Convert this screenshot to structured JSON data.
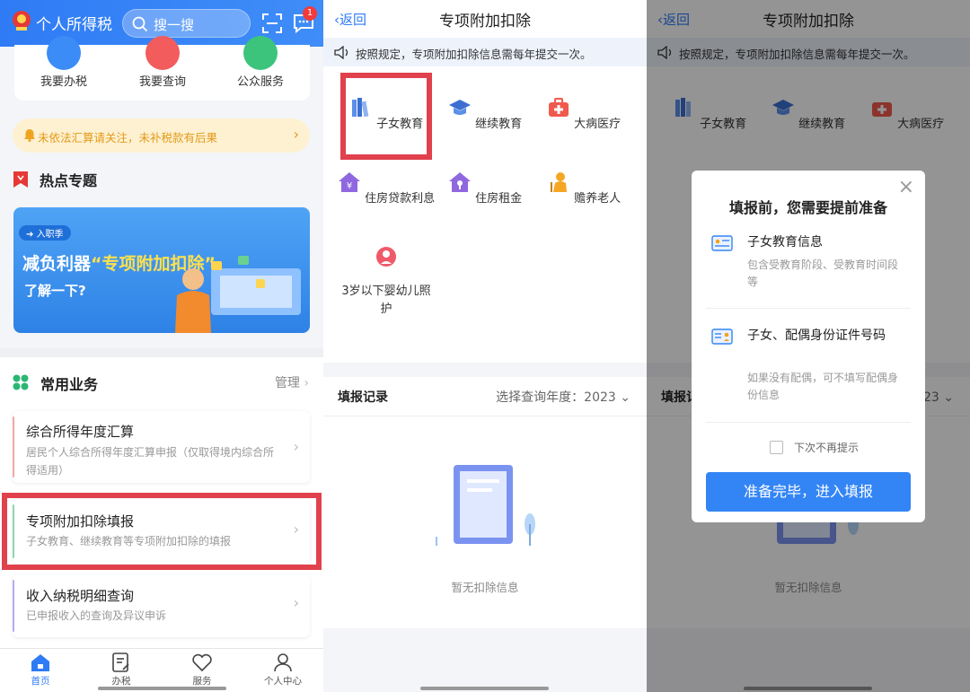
{
  "panel1": {
    "app_title": "个人所得税",
    "search_placeholder": "搜一搜",
    "message_badge": "1",
    "quick_actions": [
      "我要办税",
      "我要查询",
      "公众服务"
    ],
    "warning": "未依法汇算请关注，未补税款有后果",
    "hot_topics_title": "热点专题",
    "banner": {
      "tag": "入职季",
      "line1": "减负利器",
      "line1_quote": "“专项附加扣除”",
      "line2": "了解一下?"
    },
    "common_title": "常用业务",
    "manage_label": "管理",
    "services": [
      {
        "title": "综合所得年度汇算",
        "desc": "居民个人综合所得年度汇算申报（仅取得境内综合所得适用）"
      },
      {
        "title": "专项附加扣除填报",
        "desc": "子女教育、继续教育等专项附加扣除的填报"
      },
      {
        "title": "收入纳税明细查询",
        "desc": "已申报收入的查询及异议申诉"
      }
    ],
    "tabs": [
      "首页",
      "办税",
      "服务",
      "个人中心"
    ]
  },
  "panel2": {
    "back_label": "返回",
    "title": "专项附加扣除",
    "notice": "按照规定，专项附加扣除信息需每年提交一次。",
    "items": [
      "子女教育",
      "继续教育",
      "大病医疗",
      "住房贷款利息",
      "住房租金",
      "赡养老人",
      "3岁以下婴幼儿照护"
    ],
    "record_label": "填报记录",
    "year_label": "选择查询年度：2023",
    "empty_text": "暂无扣除信息"
  },
  "panel3": {
    "modal_title": "填报前，您需要提前准备",
    "items": [
      {
        "title": "子女教育信息",
        "desc": "包含受教育阶段、受教育时间段等"
      },
      {
        "title": "子女、配偶身份证件号码",
        "desc": "如果没有配偶，可不填写配偶身份信息"
      }
    ],
    "dont_remind": "下次不再提示",
    "confirm_button": "准备完毕，进入填报"
  },
  "colors": {
    "primary": "#2f7bf5",
    "highlight": "#e0414d",
    "warning_text": "#e49a17"
  }
}
